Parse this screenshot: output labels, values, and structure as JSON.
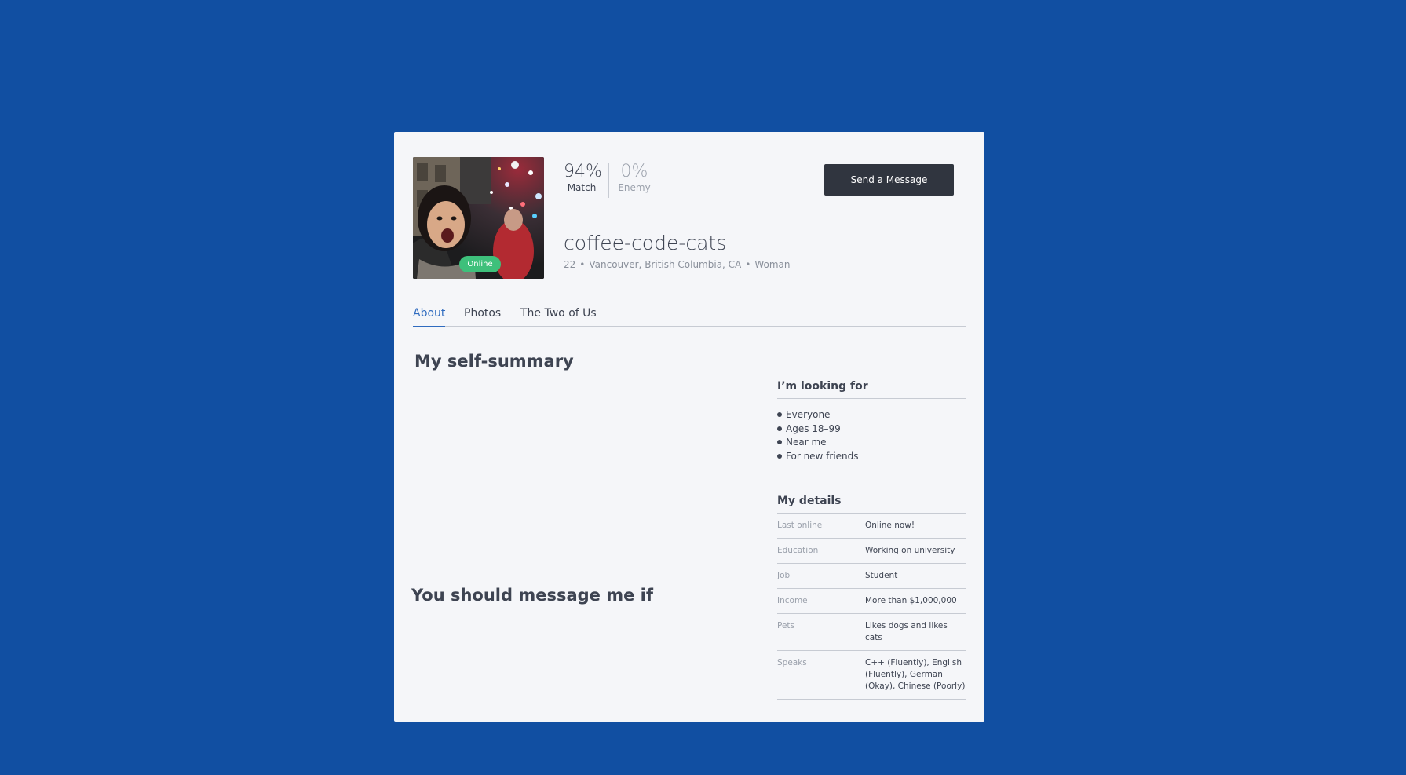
{
  "profile": {
    "photo_alt": "",
    "online_badge": "Online",
    "match_value": "94%",
    "match_label": "Match",
    "enemy_value": "0%",
    "enemy_label": "Enemy",
    "send_message_label": "Send a Message",
    "username": "coffee-code-cats",
    "age": "22",
    "location": "Vancouver, British Columbia, CA",
    "gender": "Woman",
    "separator": "•"
  },
  "tabs": [
    {
      "label": "About",
      "active": true
    },
    {
      "label": "Photos",
      "active": false
    },
    {
      "label": "The Two of Us",
      "active": false
    }
  ],
  "main": {
    "self_summary_title": "My self-summary",
    "message_me_title": "You should message me if"
  },
  "looking_for": {
    "title": "I’m looking for",
    "items": [
      "Everyone",
      "Ages 18–99",
      "Near me",
      "For new friends"
    ]
  },
  "details": {
    "title": "My details",
    "rows": [
      {
        "key": "Last online",
        "value": "Online now!"
      },
      {
        "key": "Education",
        "value": "Working on university"
      },
      {
        "key": "Job",
        "value": "Student"
      },
      {
        "key": "Income",
        "value": "More than $1,000,000"
      },
      {
        "key": "Pets",
        "value": "Likes dogs and likes cats"
      },
      {
        "key": "Speaks",
        "value": "C++ (Fluently), English (Fluently), German (Okay), Chinese (Poorly)"
      }
    ]
  },
  "colors": {
    "page_background": "#114fa2",
    "card_background": "#f5f6f9",
    "accent_tab": "#2f6bbf",
    "online_badge": "#3ec07b",
    "button": "#30353f"
  }
}
